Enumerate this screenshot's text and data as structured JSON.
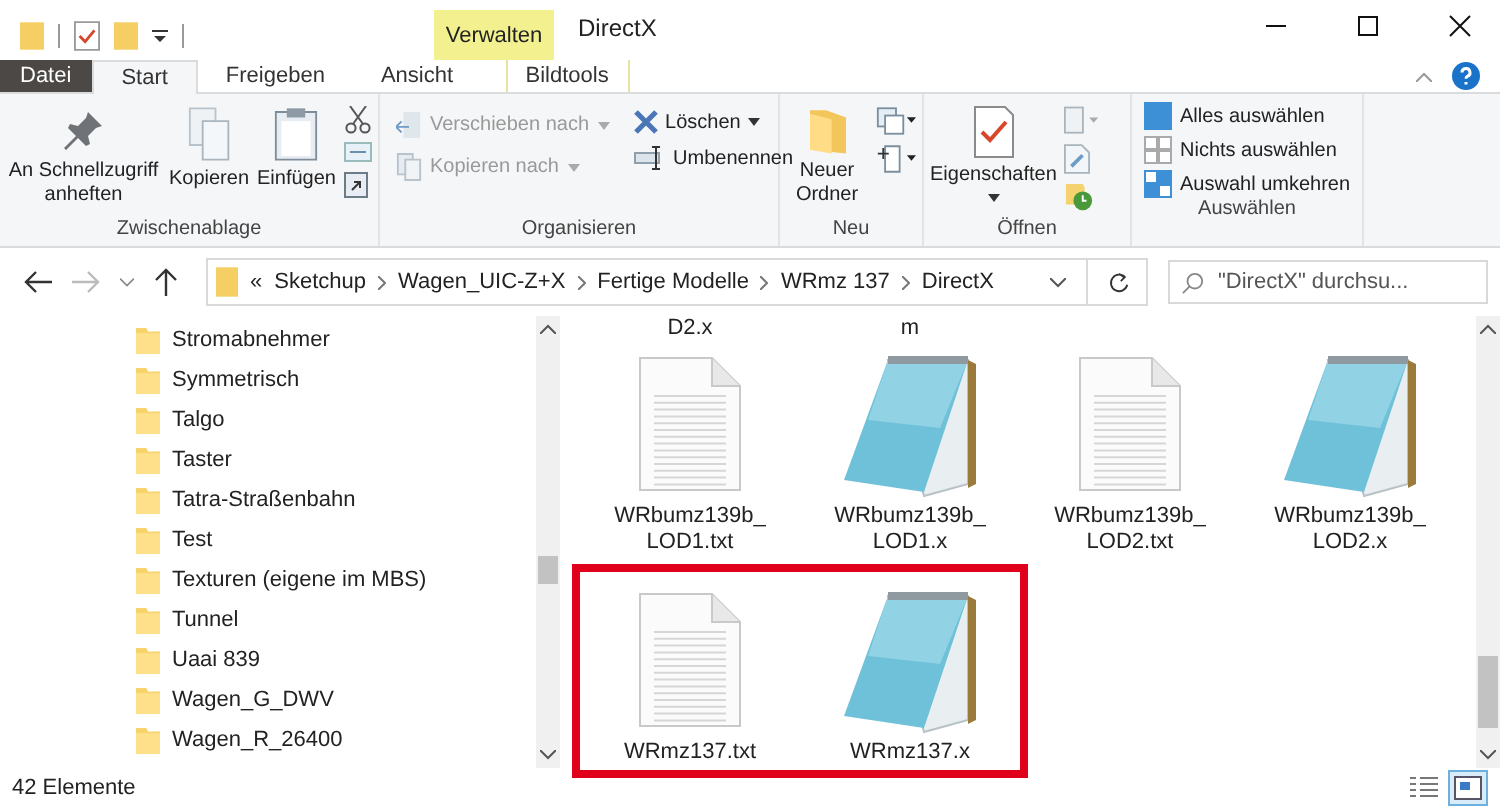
{
  "window": {
    "title": "DirectX",
    "context_label": "Verwalten"
  },
  "tabs": [
    {
      "label": "Datei",
      "kind": "file",
      "selected": false
    },
    {
      "label": "Start",
      "kind": "tab",
      "selected": true
    },
    {
      "label": "Freigeben",
      "kind": "tab",
      "selected": false
    },
    {
      "label": "Ansicht",
      "kind": "tab",
      "selected": false
    },
    {
      "label": "Bildtools",
      "kind": "context",
      "selected": false
    }
  ],
  "ribbon": {
    "groups": [
      {
        "label": "Zwischenablage",
        "buttons": [
          {
            "label": "An Schnellzugriff anheften",
            "disabled": false
          },
          {
            "label": "Kopieren",
            "disabled": false
          },
          {
            "label": "Einfügen",
            "disabled": false
          }
        ]
      },
      {
        "label": "Organisieren",
        "buttons": [
          {
            "label": "Verschieben nach",
            "disabled": true,
            "dropdown": true
          },
          {
            "label": "Kopieren nach",
            "disabled": true,
            "dropdown": true
          },
          {
            "label": "Löschen",
            "disabled": false,
            "dropdown": true
          },
          {
            "label": "Umbenennen",
            "disabled": false,
            "dropdown": false
          }
        ]
      },
      {
        "label": "Neu",
        "buttons": [
          {
            "label": "Neuer Ordner",
            "disabled": false
          }
        ]
      },
      {
        "label": "Öffnen",
        "buttons": [
          {
            "label": "Eigenschaften",
            "disabled": false,
            "dropdown": true
          }
        ]
      },
      {
        "label": "Auswählen",
        "buttons": [
          {
            "label": "Alles auswählen"
          },
          {
            "label": "Nichts auswählen"
          },
          {
            "label": "Auswahl umkehren"
          }
        ]
      }
    ]
  },
  "address": {
    "overflow_mark": "«",
    "crumbs": [
      "Sketchup",
      "Wagen_UIC-Z+X",
      "Fertige Modelle",
      "WRmz 137",
      "DirectX"
    ]
  },
  "search": {
    "placeholder": "\"DirectX\" durchsu..."
  },
  "tree": {
    "items": [
      "Stromabnehmer",
      "Symmetrisch",
      "Talgo",
      "Taster",
      "Tatra-Straßenbahn",
      "Test",
      "Texturen (eigene im MBS)",
      "Tunnel",
      "Uaai 839",
      "Wagen_G_DWV",
      "Wagen_R_26400"
    ]
  },
  "files": {
    "partial_labels": [
      "D2.x",
      "m"
    ],
    "rows": [
      {
        "highlighted": false,
        "items": [
          {
            "name": "WRbumz139b_LOD1.txt",
            "kind": "txt"
          },
          {
            "name": "WRbumz139b_LOD1.x",
            "kind": "x"
          },
          {
            "name": "WRbumz139b_LOD2.txt",
            "kind": "txt"
          },
          {
            "name": "WRbumz139b_LOD2.x",
            "kind": "x"
          }
        ]
      },
      {
        "highlighted": true,
        "items": [
          {
            "name": "WRmz137.txt",
            "kind": "txt"
          },
          {
            "name": "WRmz137.x",
            "kind": "x"
          }
        ]
      }
    ]
  },
  "status": {
    "count": "42 Elemente"
  },
  "view_modes": [
    {
      "kind": "details",
      "selected": false
    },
    {
      "kind": "large-icons",
      "selected": true
    }
  ]
}
